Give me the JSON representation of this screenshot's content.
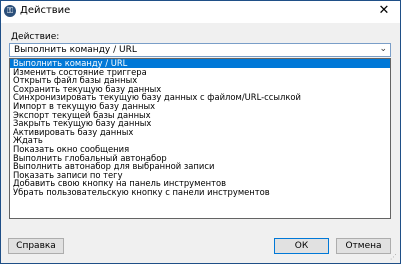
{
  "window": {
    "title": "Действие",
    "close_glyph": "✕",
    "app_icon": "lock-icon"
  },
  "form": {
    "action_label": "Действие:",
    "selected_value": "Выполнить команду / URL"
  },
  "dropdown": {
    "items": [
      "Выполнить команду / URL",
      "Изменить состояние триггера",
      "Открыть файл базы данных",
      "Сохранить текущую базу данных",
      "Синхронизировать текущую базу данных с файлом/URL-ссылкой",
      "Импорт в текущую базу данных",
      "Экспорт текущей базы данных",
      "Закрыть текущую базу данных",
      "Активировать базу данных",
      "Ждать",
      "Показать окно сообщения",
      "Выполнить глобальный автонабор",
      "Выполнить автонабор для выбранной записи",
      "Показать записи по тегу",
      "Добавить свою кнопку на панель инструментов",
      "Убрать пользовательскую кнопку с панели инструментов"
    ]
  },
  "buttons": {
    "help": "Справка",
    "ok": "ОК",
    "cancel": "Отмена"
  },
  "colors": {
    "accent": "#0078d7",
    "border": "#1f4f87"
  }
}
